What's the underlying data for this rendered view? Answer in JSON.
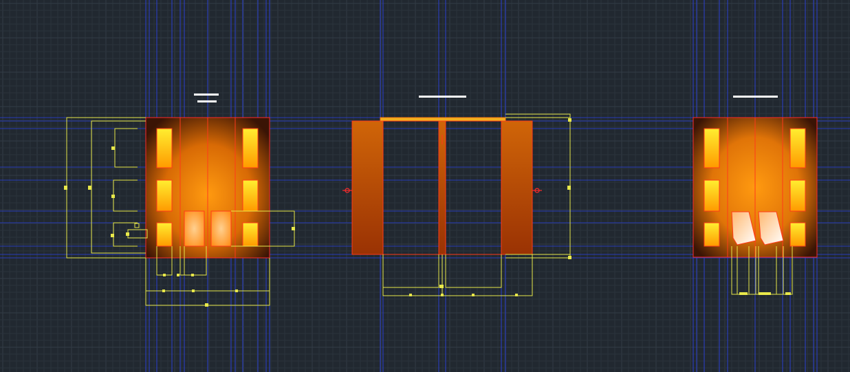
{
  "app": {
    "view": "CAD model space",
    "background_color": "#212830",
    "grid_minor_color": "#2b333c",
    "grid_major_color": "#333c46",
    "construction_line_color": "#2a3fd0",
    "dimension_color": "#e8e84a",
    "section_line_color": "#ff2a2a",
    "title_bar_color": "#ffffff"
  },
  "drawings": [
    {
      "name": "left-elevation",
      "style": "double-door-with-panels",
      "title": "",
      "title_style": "double-dashed-bar"
    },
    {
      "name": "center-elevation",
      "style": "sliding-door-frame",
      "title": "",
      "title_style": "single-bar"
    },
    {
      "name": "right-elevation",
      "style": "double-door-with-louvers",
      "title": "",
      "title_style": "single-bar"
    }
  ],
  "icons": [
    "section-marker-icon",
    "section-marker-icon"
  ]
}
